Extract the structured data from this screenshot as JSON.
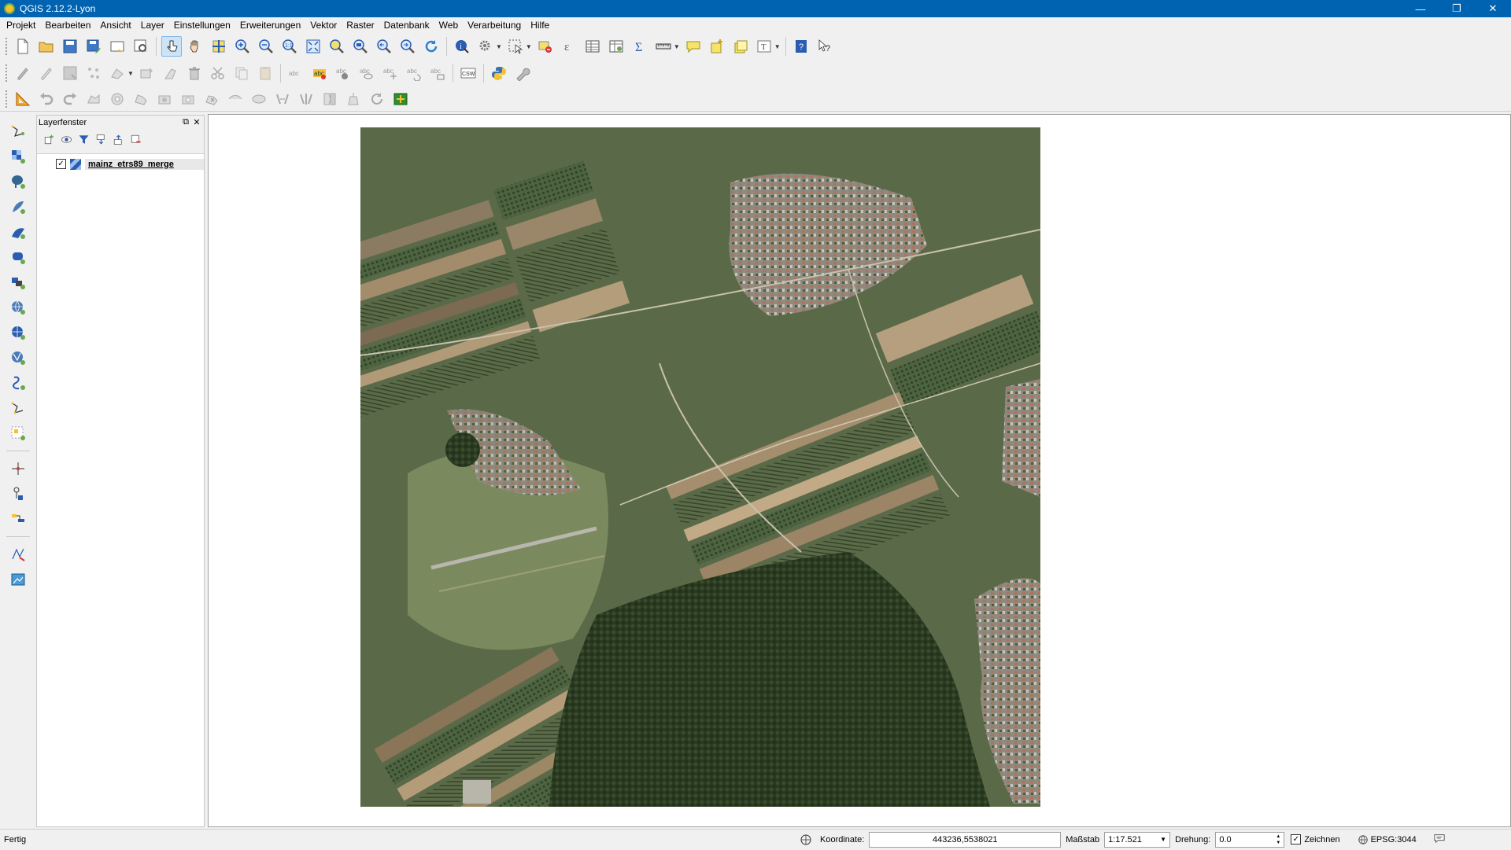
{
  "window": {
    "title": "QGIS 2.12.2-Lyon",
    "controls": [
      "minimize",
      "restore",
      "close"
    ]
  },
  "menu": [
    "Projekt",
    "Bearbeiten",
    "Ansicht",
    "Layer",
    "Einstellungen",
    "Erweiterungen",
    "Vektor",
    "Raster",
    "Datenbank",
    "Web",
    "Verarbeitung",
    "Hilfe"
  ],
  "toolbar": {
    "csw_label": "CSW",
    "abc_label": "abc"
  },
  "layers_panel": {
    "title": "Layerfenster",
    "layers": [
      {
        "name": "mainz_etrs89_merge",
        "visible": true,
        "type": "raster"
      }
    ]
  },
  "status": {
    "message": "Fertig",
    "coordinate_label": "Koordinate:",
    "coordinate_value": "443236,5538021",
    "scale_label": "Maßstab",
    "scale_value": "1:17.521",
    "rotation_label": "Drehung:",
    "rotation_value": "0.0",
    "render_label": "Zeichnen",
    "render_checked": true,
    "crs": "EPSG:3044"
  },
  "colors": {
    "titlebar": "#0063b1",
    "accent": "#cde4f7"
  }
}
